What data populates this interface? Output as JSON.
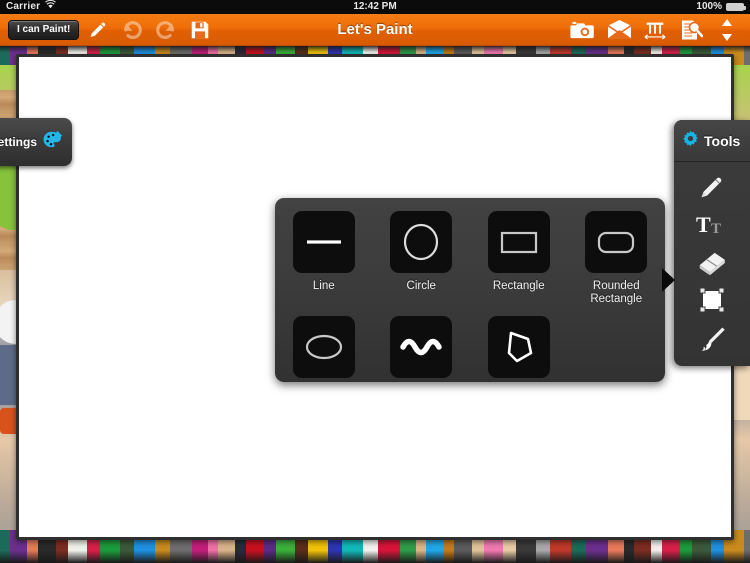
{
  "status_bar": {
    "carrier": "Carrier",
    "wifi_icon": "wifi-icon",
    "time": "12:42 PM",
    "battery_percent": "100%",
    "battery_icon": "battery-full-icon"
  },
  "toolbar": {
    "title": "Let's Paint",
    "brand_button": "I can Paint!",
    "left_icons": [
      {
        "name": "pencil-icon",
        "label": "Draw",
        "disabled": false
      },
      {
        "name": "undo-icon",
        "label": "Undo",
        "disabled": true
      },
      {
        "name": "redo-icon",
        "label": "Redo",
        "disabled": true
      },
      {
        "name": "save-icon",
        "label": "Save",
        "disabled": false
      }
    ],
    "right_icons": [
      {
        "name": "camera-icon",
        "label": "Camera",
        "disabled": false
      },
      {
        "name": "mail-icon",
        "label": "Email",
        "disabled": false
      },
      {
        "name": "ruler-icon",
        "label": "Measure",
        "disabled": false
      },
      {
        "name": "document-search-icon",
        "label": "Inspect",
        "disabled": false
      },
      {
        "name": "updown-arrows-icon",
        "label": "Reorder",
        "disabled": false
      }
    ]
  },
  "settings_tab": {
    "label": "Settings",
    "icon": "palette-brush-icon",
    "icon_color": "#22b7e8"
  },
  "tools_panel": {
    "title": "Tools",
    "header_icon": "gear-icon",
    "header_icon_color": "#17b4e8",
    "items": [
      {
        "name": "pencil-tool-icon",
        "label": "Pencil"
      },
      {
        "name": "text-tool-icon",
        "label": "Text"
      },
      {
        "name": "eraser-tool-icon",
        "label": "Eraser"
      },
      {
        "name": "selection-tool-icon",
        "label": "Select"
      },
      {
        "name": "paintbrush-tool-icon",
        "label": "Brush"
      }
    ]
  },
  "shapes_panel": {
    "shapes": [
      {
        "label": "Line",
        "icon": "line-shape-icon"
      },
      {
        "label": "Circle",
        "icon": "circle-shape-icon"
      },
      {
        "label": "Rectangle",
        "icon": "rectangle-shape-icon"
      },
      {
        "label": "Rounded Rectangle",
        "icon": "rounded-rectangle-shape-icon"
      },
      {
        "label": "",
        "icon": "ellipse-shape-icon"
      },
      {
        "label": "",
        "icon": "wave-shape-icon"
      },
      {
        "label": "",
        "icon": "polygon-shape-icon"
      },
      {
        "label": "",
        "icon": ""
      }
    ]
  },
  "canvas": {
    "background_color": "#ffffff"
  },
  "pencil_colors": [
    "#1c6b5a",
    "#6c2f8f",
    "#e87a5a",
    "#2a2a2a",
    "#7d2d22",
    "#f0f0ea",
    "#d81f4a",
    "#1c9b3c",
    "#3c5a3a",
    "#1f8fe0",
    "#c98a1e",
    "#6d6d6d",
    "#c21f7a",
    "#f06fa8",
    "#d8b48a",
    "#2a2a3a",
    "#c9101f",
    "#5b2a86",
    "#3bb03b",
    "#5a2f1a",
    "#f0c20a",
    "#2d35b0",
    "#12b8b8",
    "#f2f2f0",
    "#d8143a",
    "#2f9c4a",
    "#d9b489",
    "#1fa8e8",
    "#c9791a",
    "#5c5c5c",
    "#e0c39a",
    "#ef79b0",
    "#e8cba6",
    "#3a3a3a",
    "#a8a8a8",
    "#c0392b"
  ]
}
